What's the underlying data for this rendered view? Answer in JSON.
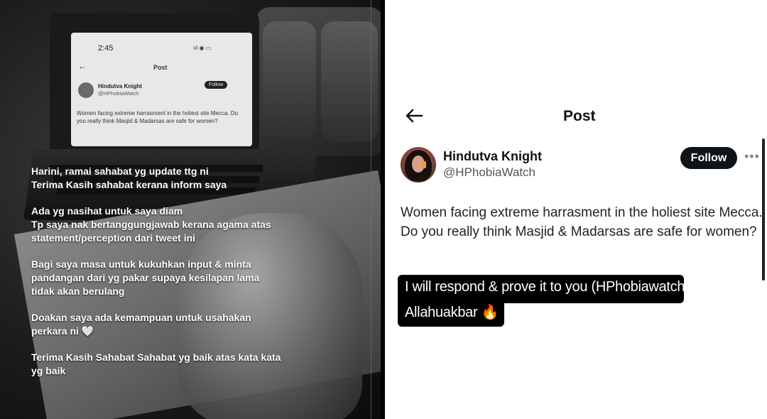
{
  "left_panel": {
    "mini_post": {
      "time": "2:45",
      "status": "ııl ◉ ▭",
      "title": "Post",
      "name": "Hindutva Knight",
      "handle": "@HPhobiaWatch",
      "follow": "Follow",
      "body": "Women facing extreme harrasment in the holiest site Mecca. Do you really think Masjid & Madarsas are safe for women?"
    },
    "caption": [
      "Harini, ramai sahabat yg update ttg ni\nTerima Kasih sahabat kerana inform saya",
      "Ada yg nasihat untuk saya diam\nTp saya nak bertanggungjawab kerana agama atas\nstatement/perception dari tweet ini",
      "Bagi saya masa untuk kukuhkan input & minta\npandangan dari yg pakar supaya kesilapan lama\ntidak akan berulang",
      "Doakan saya ada kemampuan untuk usahakan\nperkara ni 🤍",
      "Terima Kasih Sahabat Sahabat yg baik atas kata kata\nyg baik"
    ]
  },
  "right_panel": {
    "header": {
      "title": "Post"
    },
    "author": {
      "name": "Hindutva Knight",
      "handle": "@HPhobiaWatch"
    },
    "follow_label": "Follow",
    "more_label": "•••",
    "tweet_text": "Women facing extreme harrasment in the holiest site Mecca. Do you really think Masjid & Madarsas are safe for women?",
    "overlay_line1": "I will respond & prove it to you (HPhobiawatch)",
    "overlay_line2": "Allahuakbar 🔥"
  }
}
